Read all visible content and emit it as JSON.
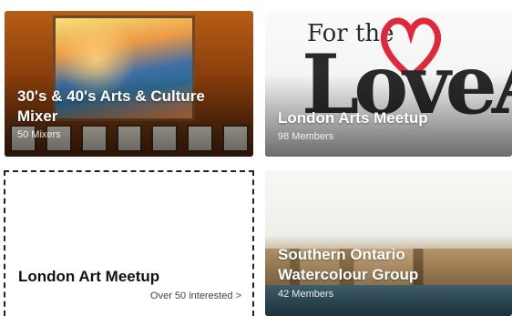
{
  "cards": [
    {
      "title": "30's & 40's Arts & Culture Mixer",
      "subtitle": "50 Mixers"
    },
    {
      "title": "London Arts Meetup",
      "subtitle": "98 Members",
      "logo_top": "For the",
      "logo_big": "LoveArt"
    },
    {
      "title": "London Art Meetup",
      "subtitle": "Over 50 interested >"
    },
    {
      "title": "Southern Ontario Watercolour Group",
      "subtitle": "42 Members"
    }
  ]
}
